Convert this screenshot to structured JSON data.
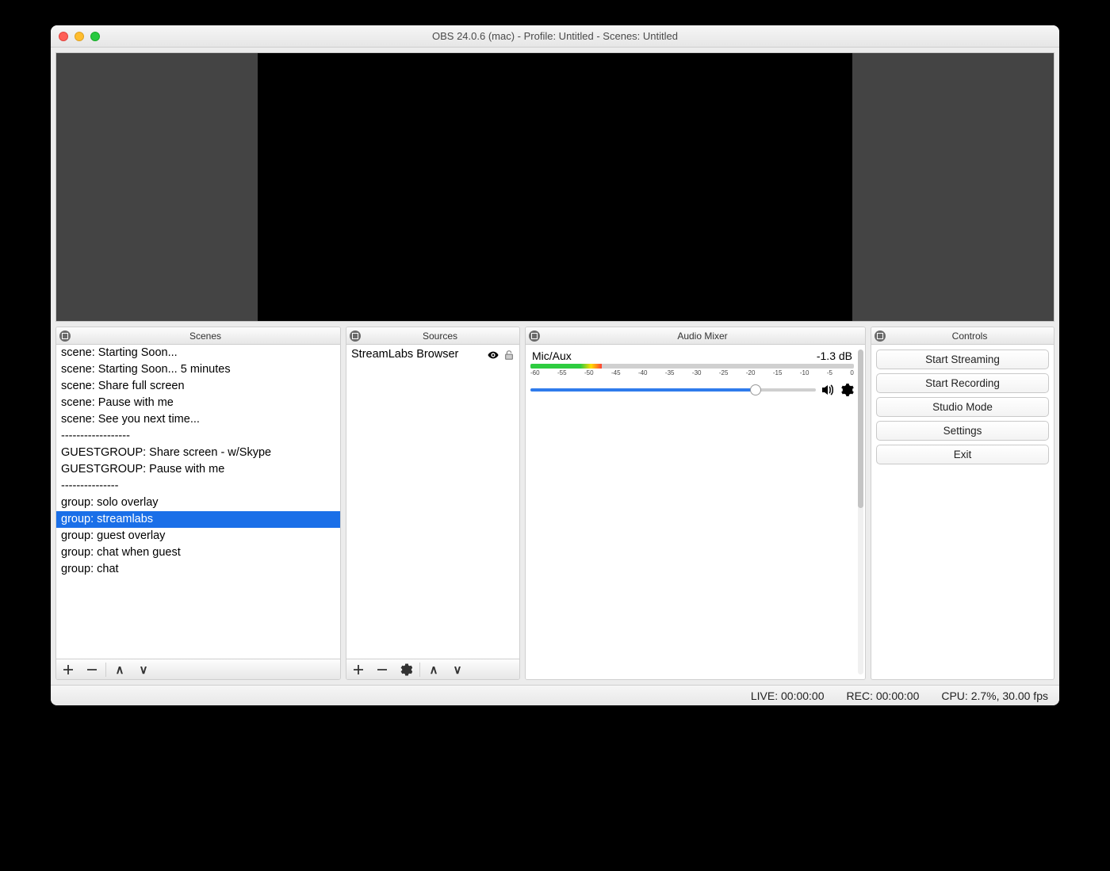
{
  "window": {
    "title": "OBS 24.0.6 (mac) - Profile: Untitled - Scenes: Untitled"
  },
  "panels": {
    "scenes_title": "Scenes",
    "sources_title": "Sources",
    "mixer_title": "Audio Mixer",
    "controls_title": "Controls"
  },
  "scenes": {
    "items": [
      "scene: Starting Soon...",
      "scene: Starting Soon... 5 minutes",
      "scene: Share full screen",
      "scene: Pause with me",
      "scene: See you next time...",
      "------------------",
      "GUESTGROUP: Share screen - w/Skype",
      "GUESTGROUP: Pause with me",
      "---------------",
      "group: solo overlay",
      "group: streamlabs",
      "group: guest overlay",
      "group: chat when guest",
      "group: chat"
    ],
    "selected_index": 10
  },
  "sources": {
    "items": [
      {
        "label": "StreamLabs Browser",
        "visible": true,
        "locked": false
      }
    ]
  },
  "mixer": {
    "channel_name": "Mic/Aux",
    "db_label": "-1.3 dB",
    "ticks": [
      "-60",
      "-55",
      "-50",
      "-45",
      "-40",
      "-35",
      "-30",
      "-25",
      "-20",
      "-15",
      "-10",
      "-5",
      "0"
    ],
    "vu_fill_pct": 22,
    "slider_pct": 79
  },
  "controls": {
    "buttons": [
      "Start Streaming",
      "Start Recording",
      "Studio Mode",
      "Settings",
      "Exit"
    ]
  },
  "status": {
    "live": "LIVE: 00:00:00",
    "rec": "REC: 00:00:00",
    "cpu": "CPU: 2.7%, 30.00 fps"
  }
}
